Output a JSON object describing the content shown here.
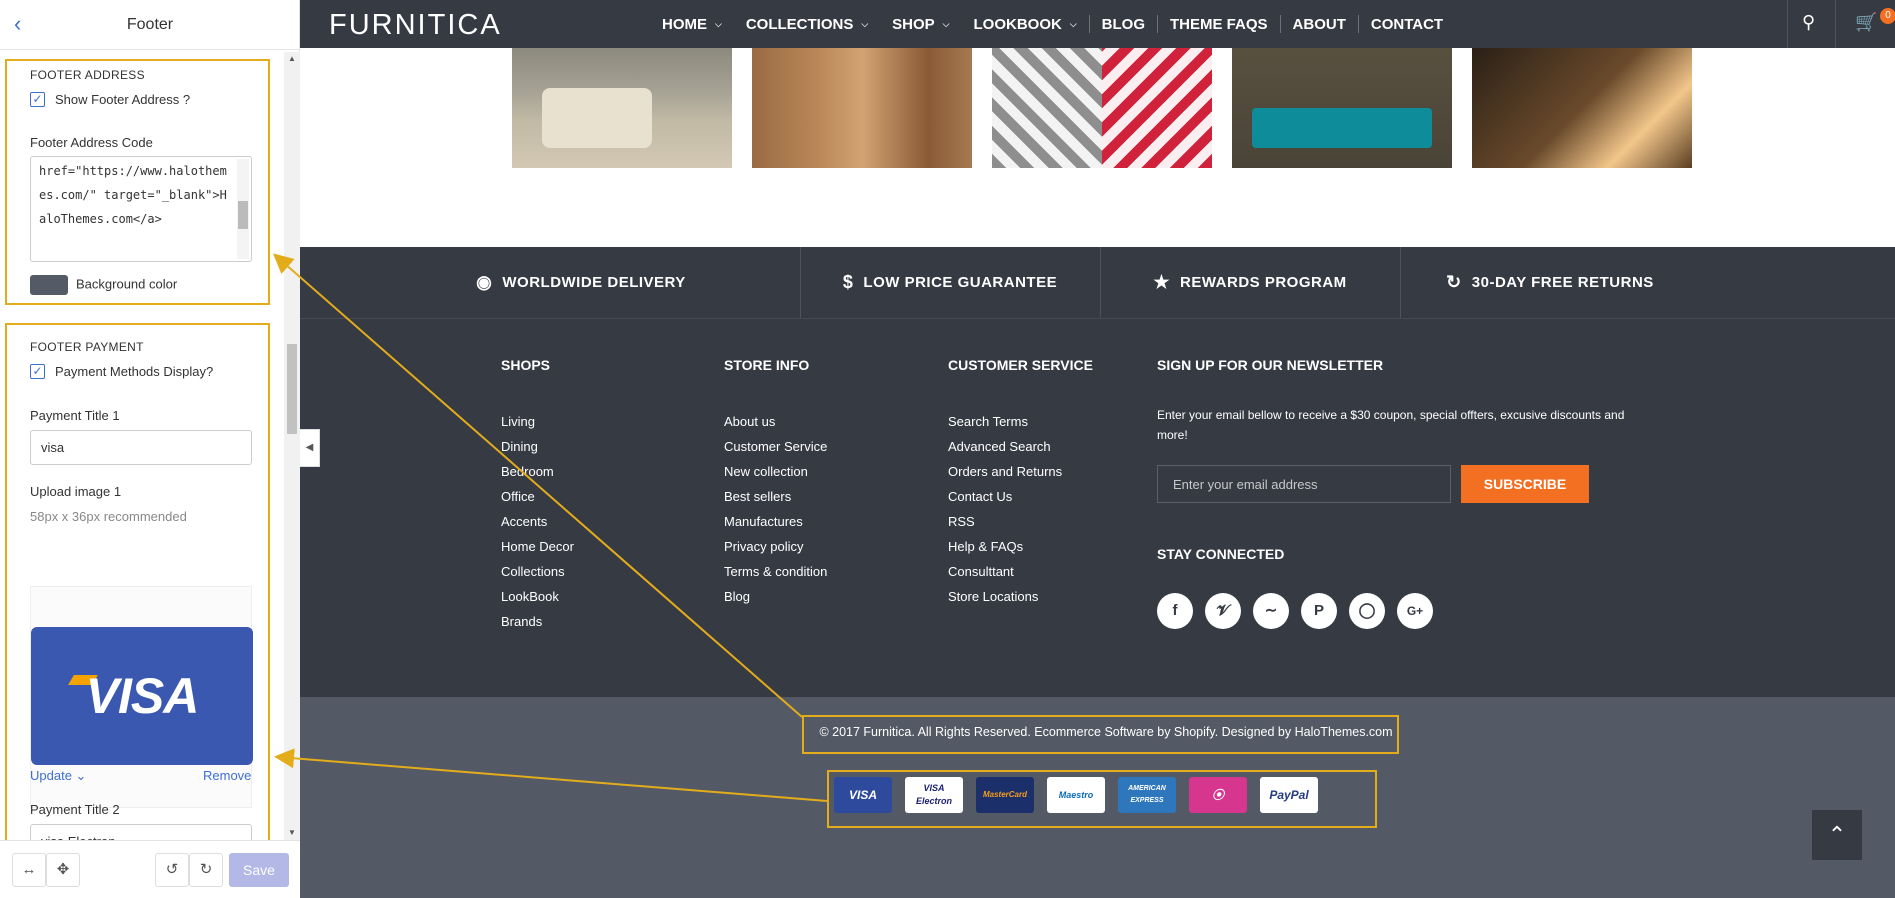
{
  "editor": {
    "back_icon": "chevron-left-icon",
    "title": "Footer",
    "footer_address": {
      "section_title": "FOOTER ADDRESS",
      "show_label": "Show Footer Address ?",
      "show_checked": true,
      "code_label": "Footer Address Code",
      "code_value": "href=\"https://www.halothemes.com/\" target=\"_blank\">HaloThemes.com</a>",
      "bg_label": "Background color",
      "bg_color": "#555b66"
    },
    "footer_payment": {
      "section_title": "FOOTER PAYMENT",
      "display_label": "Payment Methods Display?",
      "display_checked": true,
      "title1_label": "Payment Title 1",
      "title1_value": "visa",
      "image1_label": "Upload image 1",
      "image1_hint": "58px x 36px recommended",
      "image1_text": "VISA",
      "update_label": "Update",
      "remove_label": "Remove",
      "title2_label": "Payment Title 2",
      "title2_value": "visa Electron"
    },
    "save_label": "Save"
  },
  "site": {
    "logo": "FURNITICA",
    "menu": [
      {
        "label": "HOME",
        "dropdown": true
      },
      {
        "label": "COLLECTIONS",
        "dropdown": true
      },
      {
        "label": "SHOP",
        "dropdown": true
      },
      {
        "label": "LOOKBOOK",
        "dropdown": true
      },
      {
        "label": "BLOG",
        "dropdown": false
      },
      {
        "label": "THEME FAQS",
        "dropdown": false
      },
      {
        "label": "ABOUT",
        "dropdown": false
      },
      {
        "label": "CONTACT",
        "dropdown": false
      }
    ],
    "cart_count": "0",
    "features": [
      {
        "icon": "globe-icon",
        "label": "WORLDWIDE DELIVERY"
      },
      {
        "icon": "dollar-icon",
        "label": "LOW PRICE GUARANTEE"
      },
      {
        "icon": "star-icon",
        "label": "REWARDS PROGRAM"
      },
      {
        "icon": "return-icon",
        "label": "30-DAY FREE RETURNS"
      }
    ],
    "columns": [
      {
        "title": "SHOPS",
        "items": [
          "Living",
          "Dining",
          "Bedroom",
          "Office",
          "Accents",
          "Home Decor",
          "Collections",
          "LookBook",
          "Brands"
        ]
      },
      {
        "title": "STORE INFO",
        "items": [
          "About us",
          "Customer Service",
          "New collection",
          "Best sellers",
          "Manufactures",
          "Privacy policy",
          "Terms & condition",
          "Blog"
        ]
      },
      {
        "title": "CUSTOMER SERVICE",
        "items": [
          "Search Terms",
          "Advanced Search",
          "Orders and Returns",
          "Contact Us",
          "RSS",
          "Help & FAQs",
          "Consulttant",
          "Store Locations"
        ]
      }
    ],
    "newsletter": {
      "title": "SIGN UP FOR OUR NEWSLETTER",
      "text": "Enter your email bellow to receive a $30 coupon, special offters, excusive discounts and more!",
      "placeholder": "Enter your email address",
      "button": "SUBSCRIBE"
    },
    "stay_connected": "STAY CONNECTED",
    "social": [
      "facebook-icon",
      "twitter-icon",
      "rss-icon",
      "pinterest-icon",
      "instagram-icon",
      "google-plus-icon"
    ],
    "copyright": "© 2017 Furnitica. All Rights Reserved. Ecommerce Software by Shopify. Designed by HaloThemes.com",
    "payments": [
      "VISA",
      "VISA Electron",
      "MasterCard",
      "Maestro",
      "AMERICAN EXPRESS",
      "",
      "PayPal"
    ],
    "colors": {
      "dark": "#363a43",
      "bottom": "#545966",
      "accent": "#f36f21",
      "highlight": "#e3ac1b",
      "link": "#3d6fd1"
    }
  }
}
